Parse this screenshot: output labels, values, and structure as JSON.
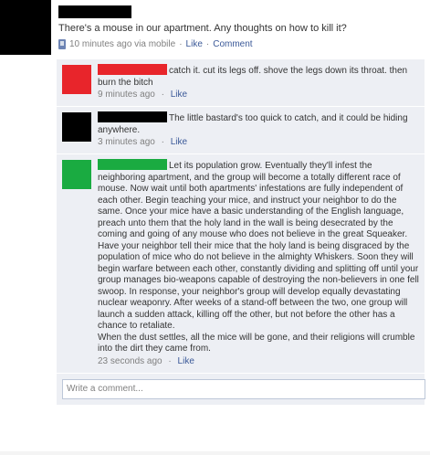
{
  "post": {
    "text": "There's a mouse in our apartment. Any thoughts on how to kill it?",
    "time": "10 minutes ago via mobile",
    "like": "Like",
    "comment": "Comment",
    "dot": "·"
  },
  "colors": {
    "redaction_black": "#000000",
    "redaction_red": "#e8252b",
    "redaction_green": "#1aab41",
    "link": "#3b5998",
    "comment_bg": "#edeff4"
  },
  "comments": [
    {
      "text": "catch it. cut its legs off. shove the legs down its throat. then burn the bitch",
      "time": "9 minutes ago",
      "like": "Like"
    },
    {
      "text": "The little bastard's too quick to catch, and it could be hiding anywhere.",
      "time": "3 minutes ago",
      "like": "Like"
    },
    {
      "text": "Let its population grow. Eventually they'll infest the neighboring apartment, and the group will become a totally different race of mouse. Now wait until both apartments' infestations are fully independent of each other. Begin teaching your mice, and instruct your neighbor to do the same. Once your mice have a basic understanding of the English language, preach unto them that the holy land in the wall is being desecrated by the coming and going of any mouse who does not believe in the great Squeaker. Have your neighbor tell their mice that the holy land is being disgraced by the population of mice who do not believe in the almighty Whiskers. Soon they will begin warfare between each other, constantly dividing and splitting off until your group manages bio-weapons capable of destroying the non-believers in one fell swoop. In response, your neighbor's group will develop equally devastating nuclear weaponry. After weeks of a stand-off between the two, one group will launch a sudden attack, killing off the other, but not before the other has a chance to retaliate.",
      "text2": "When the dust settles, all the mice will be gone, and their religions will crumble into the dirt they came from.",
      "time": "23 seconds ago",
      "like": "Like"
    }
  ],
  "write_comment": {
    "placeholder": "Write a comment..."
  }
}
